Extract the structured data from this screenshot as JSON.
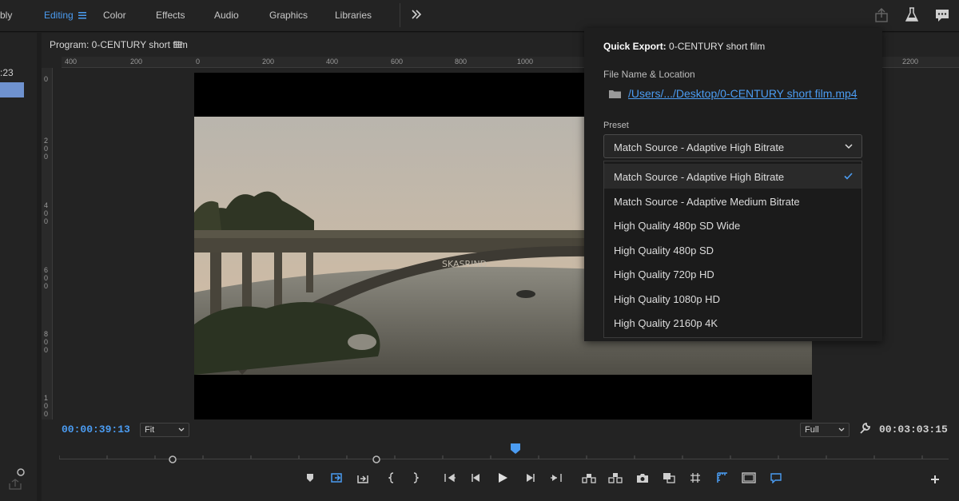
{
  "workspace_tabs": [
    "bly",
    "Editing",
    "Color",
    "Effects",
    "Audio",
    "Graphics",
    "Libraries"
  ],
  "active_tab": "Editing",
  "more_icon": "double-chevron-right-icon",
  "left_panel": {
    "partial_timecode": ":23"
  },
  "program": {
    "title": "Program: 0-CENTURY short film",
    "ruler_h": [
      "400",
      "200",
      "0",
      "200",
      "400",
      "600",
      "800",
      "1000",
      "2200"
    ],
    "ruler_v": [
      "0",
      "2\n0\n0",
      "4\n0\n0",
      "6\n0\n0",
      "8\n0\n0",
      "1\n0\n0"
    ],
    "timecode_current": "00:00:39:13",
    "timecode_duration": "00:03:03:15",
    "zoom": "Fit",
    "resolution": "Full"
  },
  "quick_export": {
    "title_bold": "Quick Export:",
    "title_rest": " 0-CENTURY short film",
    "file_label": "File Name & Location",
    "file_path": "/Users/.../Desktop/0-CENTURY short film.mp4",
    "preset_label": "Preset",
    "preset_value": "Match Source - Adaptive High Bitrate",
    "options": [
      "Match Source - Adaptive High Bitrate",
      "Match Source - Adaptive Medium Bitrate",
      "High Quality 480p SD Wide",
      "High Quality 480p SD",
      "High Quality 720p HD",
      "High Quality 1080p HD",
      "High Quality 2160p 4K"
    ],
    "selected_index": 0
  },
  "colors": {
    "accent": "#4b9cf2",
    "panel": "#232323",
    "bg": "#1d1d1d"
  }
}
